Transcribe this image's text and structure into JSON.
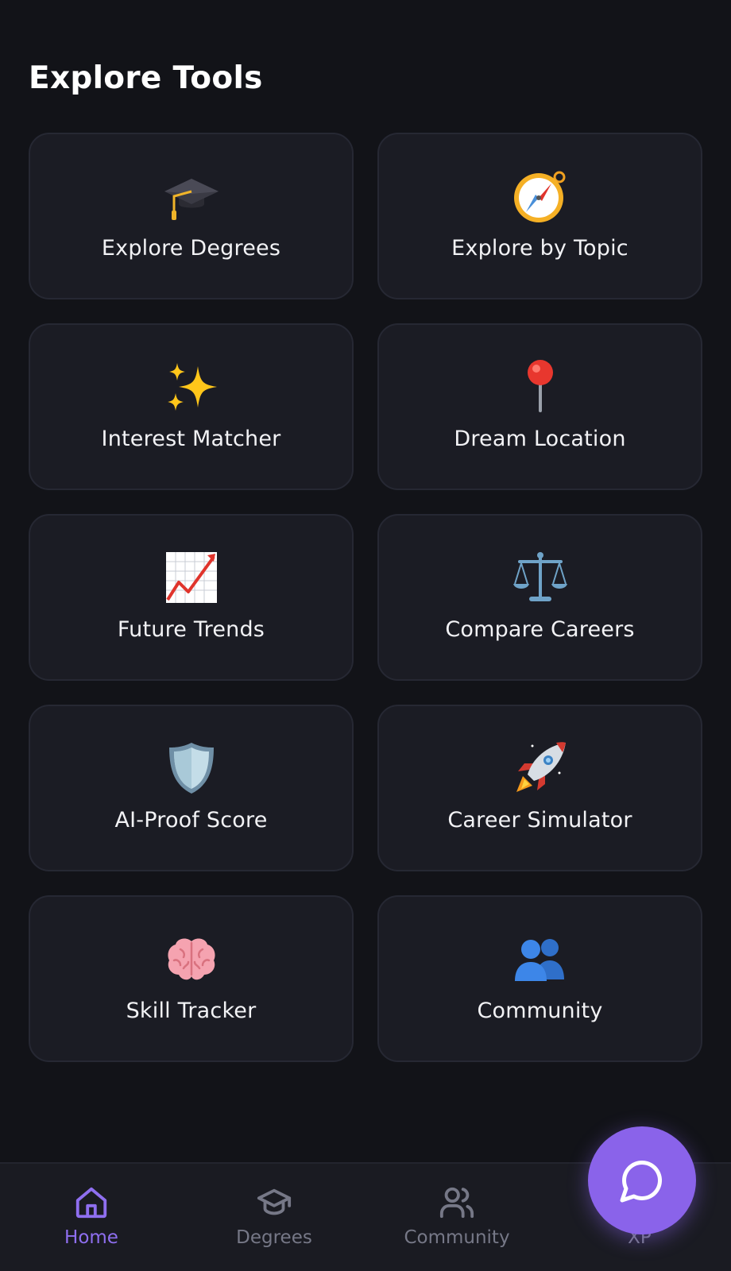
{
  "section": {
    "title": "Explore Tools"
  },
  "tools": [
    {
      "label": "Explore Degrees",
      "icon": "graduation-cap-icon"
    },
    {
      "label": "Explore by Topic",
      "icon": "compass-icon"
    },
    {
      "label": "Interest Matcher",
      "icon": "sparkles-icon"
    },
    {
      "label": "Dream Location",
      "icon": "round-pushpin-icon"
    },
    {
      "label": "Future Trends",
      "icon": "chart-increasing-icon"
    },
    {
      "label": "Compare Careers",
      "icon": "balance-scale-icon"
    },
    {
      "label": "AI-Proof Score",
      "icon": "shield-icon"
    },
    {
      "label": "Career Simulator",
      "icon": "rocket-icon"
    },
    {
      "label": "Skill Tracker",
      "icon": "brain-icon"
    },
    {
      "label": "Community",
      "icon": "people-icon"
    }
  ],
  "nav": {
    "items": [
      {
        "label": "Home",
        "icon": "home-icon",
        "active": true
      },
      {
        "label": "Degrees",
        "icon": "graduation-cap-outline-icon",
        "active": false
      },
      {
        "label": "Community",
        "icon": "users-icon",
        "active": false
      },
      {
        "label": "XP",
        "icon": "",
        "active": false
      }
    ]
  },
  "fab": {
    "icon": "chat-bubble-icon"
  },
  "colors": {
    "background": "#121318",
    "card": "#1b1c24",
    "accent": "#8a63ea",
    "nav_active": "#8f6ff0",
    "nav_inactive": "#767887"
  }
}
